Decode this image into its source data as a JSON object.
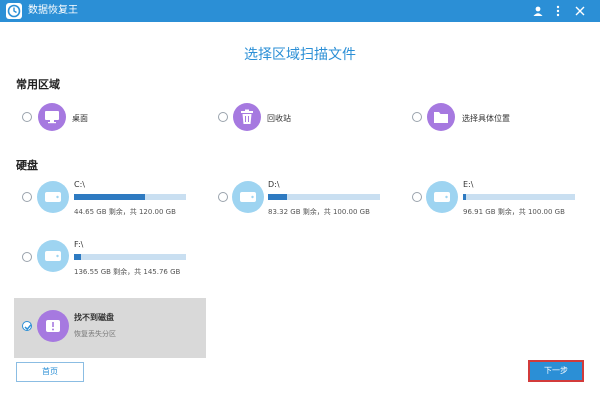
{
  "app": {
    "title": "数据恢复王"
  },
  "page": {
    "title": "选择区域扫描文件"
  },
  "common_areas": {
    "title": "常用区域",
    "items": [
      {
        "label": "桌面",
        "icon": "desktop-icon",
        "selected": false
      },
      {
        "label": "回收站",
        "icon": "recycle-bin-icon",
        "selected": false
      },
      {
        "label": "选择具体位置",
        "icon": "folder-icon",
        "selected": false
      }
    ]
  },
  "disks": {
    "title": "硬盘",
    "drives": [
      {
        "letter": "C:\\",
        "info": "44.65 GB 剩余，共 120.00 GB",
        "fill": 0.63
      },
      {
        "letter": "D:\\",
        "info": "83.32 GB 剩余，共 100.00 GB",
        "fill": 0.17
      },
      {
        "letter": "E:\\",
        "info": "96.91 GB 剩余，共 100.00 GB",
        "fill": 0.03
      },
      {
        "letter": "F:\\",
        "info": "136.55 GB 剩余，共 145.76 GB",
        "fill": 0.06
      }
    ],
    "missing": {
      "label": "找不到磁盘",
      "sublabel": "恢复丢失分区",
      "selected": true
    }
  },
  "buttons": {
    "home": "首页",
    "next": "下一步"
  },
  "colors": {
    "accent": "#2b8fd6",
    "bar_fill": "#2e7ac1",
    "bar_track": "#c9dff1",
    "purple": "#a679e0",
    "drive_circle": "#9ed4f1",
    "highlight_border": "#d23b3b"
  }
}
